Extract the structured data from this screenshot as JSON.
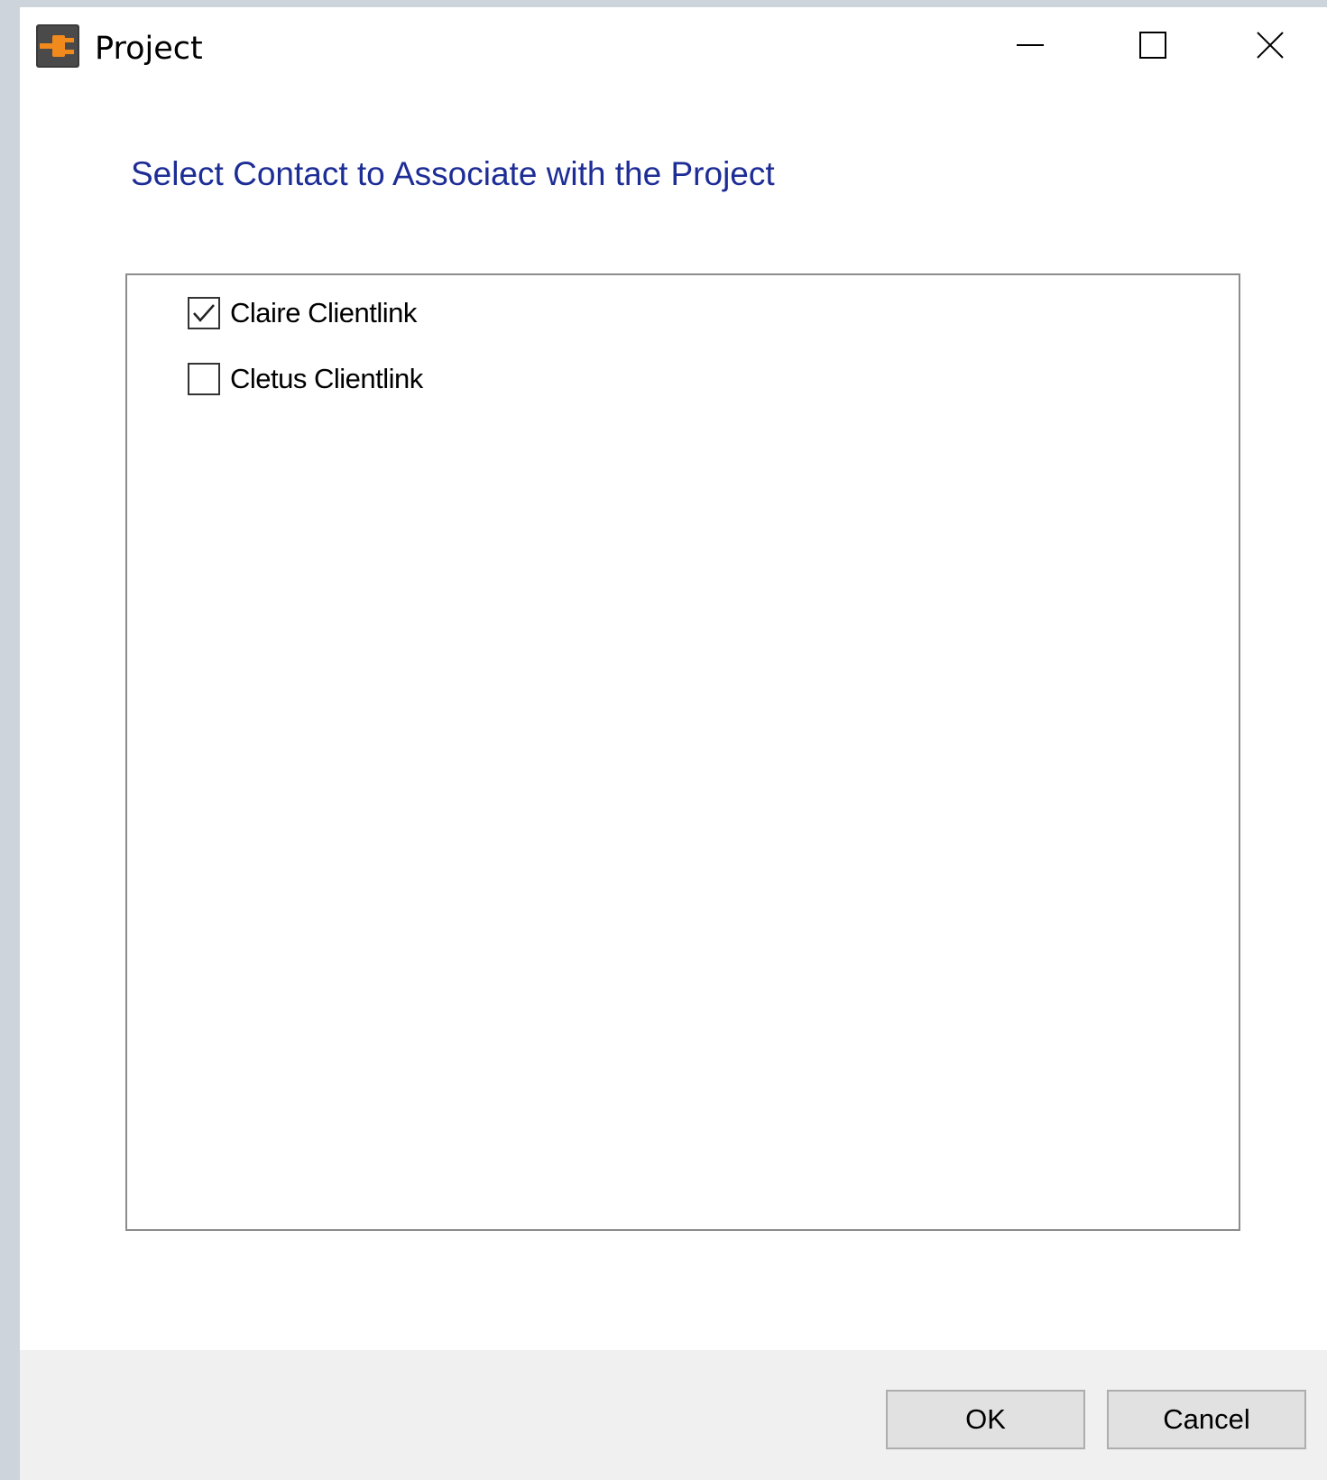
{
  "window": {
    "title": "Project",
    "icon": "orange-plug-icon",
    "controls": {
      "minimize": "minimize-icon",
      "maximize": "maximize-icon",
      "close": "close-icon"
    }
  },
  "dialog": {
    "heading": "Select Contact to Associate with the Project",
    "contacts": [
      {
        "label": "Claire Clientlink",
        "checked": true
      },
      {
        "label": "Cletus Clientlink",
        "checked": false
      }
    ]
  },
  "buttons": {
    "ok": "OK",
    "cancel": "Cancel"
  },
  "colors": {
    "heading": "#1d2d96",
    "icon_accent": "#f08a1c",
    "footer_bg": "#f0f0f0"
  }
}
